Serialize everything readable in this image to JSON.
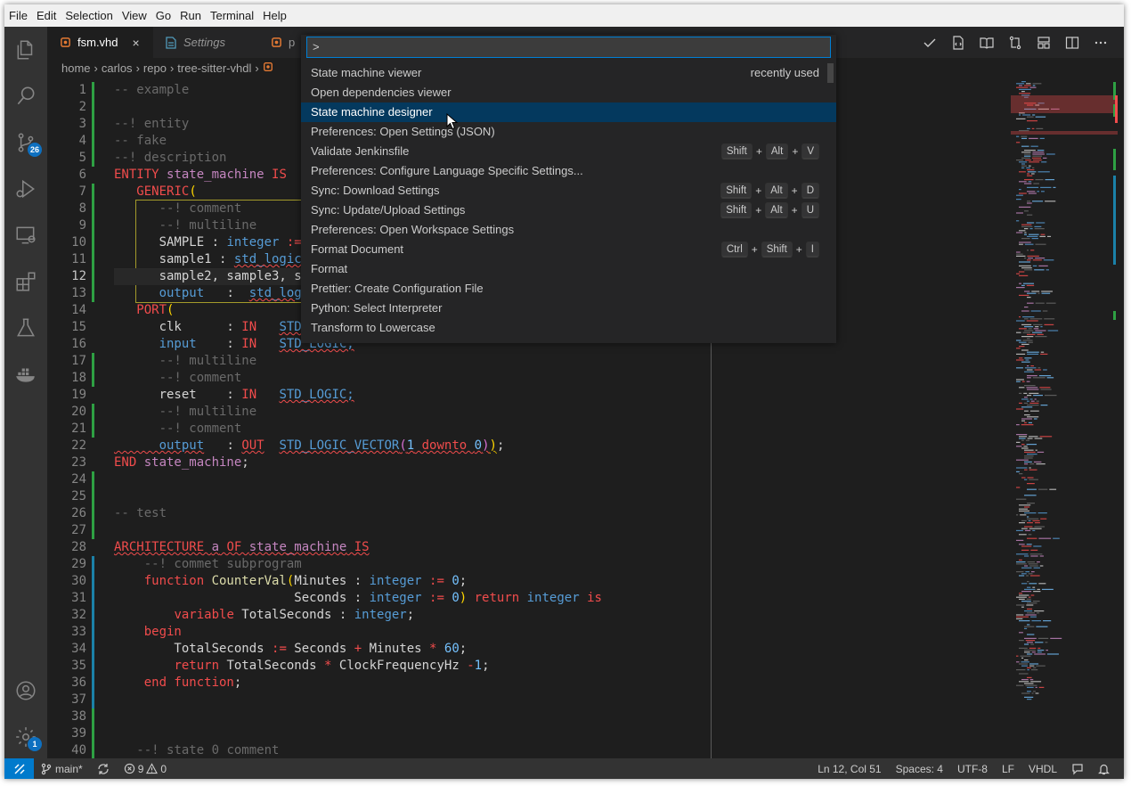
{
  "menubar": [
    "File",
    "Edit",
    "Selection",
    "View",
    "Go",
    "Run",
    "Terminal",
    "Help"
  ],
  "activity": {
    "scm_badge": "26",
    "settings_badge": "1"
  },
  "tabs": [
    {
      "label": "fsm.vhd",
      "close": "×"
    },
    {
      "label": "Settings"
    },
    {
      "label": "p"
    }
  ],
  "breadcrumb": [
    "home",
    "carlos",
    "repo",
    "tree-sitter-vhdl"
  ],
  "palette": {
    "input_value": ">",
    "items": [
      {
        "label": "State machine viewer",
        "note": "recently used"
      },
      {
        "label": "Open dependencies viewer"
      },
      {
        "label": "State machine designer",
        "selected": true
      },
      {
        "label": "Preferences: Open Settings (JSON)"
      },
      {
        "label": "Validate Jenkinsfile",
        "keys": [
          "Shift",
          "Alt",
          "V"
        ]
      },
      {
        "label": "Preferences: Configure Language Specific Settings..."
      },
      {
        "label": "Sync: Download Settings",
        "keys": [
          "Shift",
          "Alt",
          "D"
        ]
      },
      {
        "label": "Sync: Update/Upload Settings",
        "keys": [
          "Shift",
          "Alt",
          "U"
        ]
      },
      {
        "label": "Preferences: Open Workspace Settings"
      },
      {
        "label": "Format Document",
        "keys": [
          "Ctrl",
          "Shift",
          "I"
        ]
      },
      {
        "label": "Format"
      },
      {
        "label": "Prettier: Create Configuration File"
      },
      {
        "label": "Python: Select Interpreter"
      },
      {
        "label": "Transform to Lowercase"
      }
    ]
  },
  "editor": {
    "line_numbers": [
      "1",
      "2",
      "3",
      "4",
      "5",
      "6",
      "7",
      "8",
      "9",
      "10",
      "11",
      "12",
      "13",
      "14",
      "15",
      "16",
      "17",
      "18",
      "19",
      "20",
      "21",
      "22",
      "23",
      "24",
      "25",
      "26",
      "27",
      "28",
      "29",
      "30",
      "31",
      "32",
      "33",
      "34",
      "35",
      "36",
      "37",
      "38",
      "39",
      "40"
    ],
    "current_line": 12
  },
  "statusbar": {
    "branch": "main*",
    "errors": "9",
    "warnings": "0",
    "position": "Ln 12, Col 51",
    "spaces": "Spaces: 4",
    "encoding": "UTF-8",
    "eol": "LF",
    "language": "VHDL"
  },
  "colors": {
    "accent": "#007acc",
    "selection": "#04395e",
    "keyword": "#f14c4c",
    "type": "#569cd6",
    "comment": "#6a6a6a",
    "gutter_added": "#2ea043",
    "gutter_modified": "#1b81a8"
  }
}
